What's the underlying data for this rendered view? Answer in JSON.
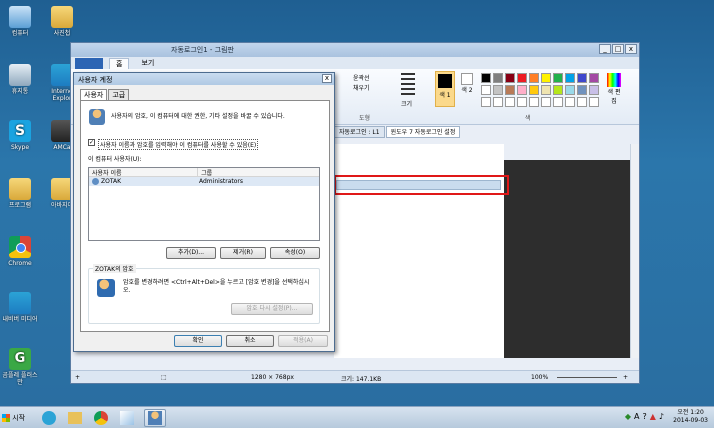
{
  "desktop": {
    "icons": [
      {
        "label": "컴퓨터",
        "kind": "pc"
      },
      {
        "label": "사진첩",
        "kind": "folder"
      },
      {
        "label": "휴지통",
        "kind": "bin"
      },
      {
        "label": "Interne Explor",
        "kind": "edge"
      },
      {
        "label": "Skype",
        "kind": "skype"
      },
      {
        "label": "AMCa",
        "kind": "amc"
      },
      {
        "label": "프로그램",
        "kind": "folder"
      },
      {
        "label": "아바지어",
        "kind": "folder"
      },
      {
        "label": "Chrome",
        "kind": "chrome"
      },
      {
        "label": "내비버 미디어",
        "kind": "edge"
      },
      {
        "label": "곰플레 플러스만",
        "kind": "green"
      }
    ]
  },
  "paint": {
    "title": "자동로그인1 - 그림판",
    "tabs": [
      "홈",
      "보기"
    ],
    "ribbon": {
      "outline_label": "윤곽선",
      "fill_label": "채우기",
      "size_label": "크기",
      "color1_label": "색 1",
      "color2_label": "색 2",
      "edit_colors_label": "색 편집",
      "shapes_label": "도형",
      "colors_label": "색"
    },
    "browser_tabs": [
      {
        "label": "자동로그인 : L1",
        "active": false
      },
      {
        "label": "윈도우 7 자동로그인 설정",
        "active": true
      }
    ],
    "status": {
      "dimensions": "1280 × 768px",
      "size": "크기: 147.1KB",
      "zoom": "100%"
    }
  },
  "dialog": {
    "title": "사용자 계정",
    "close": "x",
    "tabs": [
      "사용자",
      "고급"
    ],
    "intro": "사용자의 암호, 이 컴퓨터에 대한 권한, 기타 설정을 바꿀 수 있습니다.",
    "checkbox_label": "사용자 이름과 암호를 입력해야 이 컴퓨터를 사용할 수 있음(E)",
    "checkbox_checked": true,
    "users_label": "이 컴퓨터 사용자(U):",
    "columns": [
      "사용자 이름",
      "그룹"
    ],
    "rows": [
      {
        "name": "ZOTAK",
        "group": "Administrators"
      }
    ],
    "buttons": {
      "add": "추가(D)...",
      "remove": "제거(R)",
      "properties": "속성(O)"
    },
    "password_group_label": "ZOTAK의 암호",
    "password_text": "암호를 변경하려면 <Ctrl+Alt+Del>을 누르고 [암호 변경]을 선택하십시오.",
    "reset_password": "암호 다시 설정(P)...",
    "ok": "확인",
    "cancel": "취소",
    "apply": "적용(A)"
  },
  "taskbar": {
    "start": "시작",
    "lang": "A",
    "time": "오전 1:20",
    "date": "2014-09-03"
  }
}
